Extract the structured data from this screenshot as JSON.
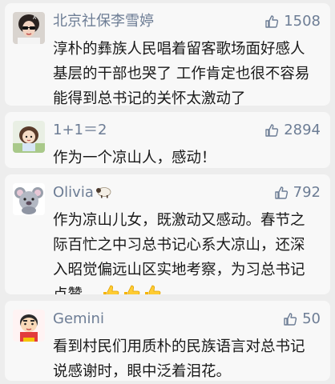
{
  "comments": [
    {
      "name": "北京社保李雪婷",
      "likes": "1508",
      "text": "淳朴的彝族人民唱着留客歌场面好感人基层的干部也哭了 工作肯定也很不容易能得到总书记的关怀太激动了",
      "avatar": "avatar-woman-sunglasses"
    },
    {
      "name": "1+1＝2",
      "likes": "2894",
      "text": "作为一个凉山人，感动！",
      "avatar": "avatar-anime-girl"
    },
    {
      "name": "Olivia",
      "name_icon": "sheep-icon",
      "likes": "792",
      "text": "作为凉山儿女，既激动又感动。春节之际百忙之中习总书记心系大凉山，还深入昭觉偏远山区实地考察，为习总书记点赞。",
      "text_emojis": [
        "thumbs-up-emoji",
        "thumbs-up-emoji",
        "thumbs-up-emoji"
      ],
      "avatar": "avatar-koala-cartoon"
    },
    {
      "name": "Gemini",
      "likes": "50",
      "text": "看到村民们用质朴的民族语言对总书记说感谢时，眼中泛着泪花。",
      "avatar": "avatar-crayon-shin-chan"
    }
  ],
  "colors": {
    "background": "#ededed",
    "card": "#f8f8f8",
    "meta_text": "#6d7d95",
    "body_text": "#1a1a1a"
  }
}
